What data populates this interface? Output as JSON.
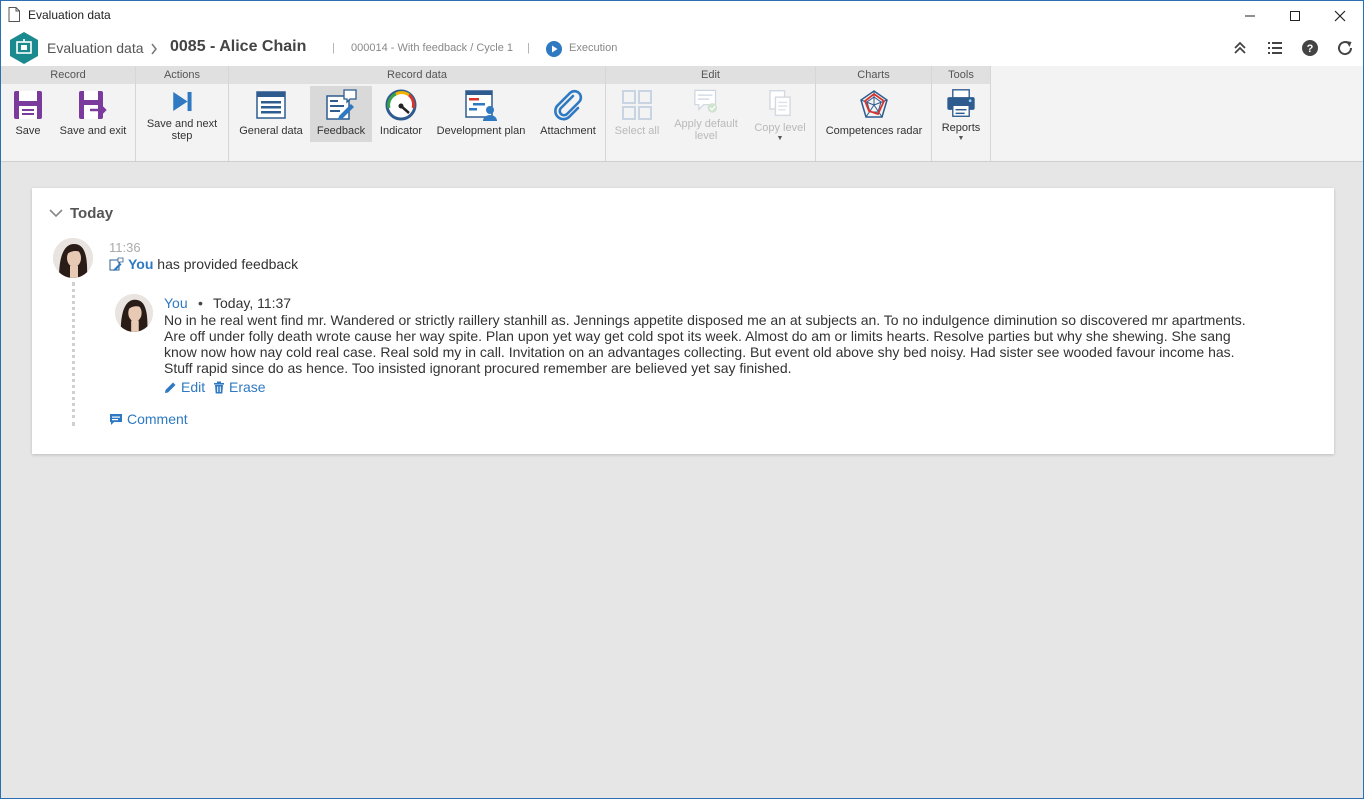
{
  "window": {
    "title": "Evaluation data"
  },
  "header": {
    "breadcrumb_root": "Evaluation data",
    "record_title": "0085 - Alice Chain",
    "context": "000014 - With feedback / Cycle 1",
    "status": "Execution"
  },
  "ribbon": {
    "groups": {
      "record": "Record",
      "actions": "Actions",
      "record_data": "Record data",
      "edit": "Edit",
      "charts": "Charts",
      "tools": "Tools"
    },
    "buttons": {
      "save": "Save",
      "save_exit": "Save and exit",
      "save_next": "Save and next step",
      "general_data": "General data",
      "feedback": "Feedback",
      "indicator": "Indicator",
      "development_plan": "Development plan",
      "attachment": "Attachment",
      "select_all": "Select all",
      "apply_default": "Apply default level",
      "copy_level": "Copy level",
      "competences_radar": "Competences radar",
      "reports": "Reports"
    }
  },
  "timeline": {
    "section": "Today",
    "entry": {
      "time": "11:36",
      "actor": "You",
      "action": "has provided feedback"
    },
    "comment": {
      "author": "You",
      "separator": "•",
      "date": "Today, 11:37",
      "text": "No in he real went find mr. Wandered or strictly raillery stanhill as. Jennings appetite disposed me an at subjects an. To no indulgence diminution so discovered mr apartments. Are off under folly death wrote cause her way spite. Plan upon yet way get cold spot its week. Almost do am or limits hearts. Resolve parties but why she shewing. She sang know now how nay cold real case. Real sold my in call. Invitation on an advantages collecting. But event old above shy bed noisy. Had sister see wooded favour income has. Stuff rapid since do as hence. Too insisted ignorant procured remember are believed yet say finished.",
      "edit_label": "Edit",
      "erase_label": "Erase"
    },
    "comment_action": "Comment"
  },
  "colors": {
    "accent": "#2e79c1",
    "logo": "#1b8a8f",
    "purple": "#7b3b9c"
  }
}
